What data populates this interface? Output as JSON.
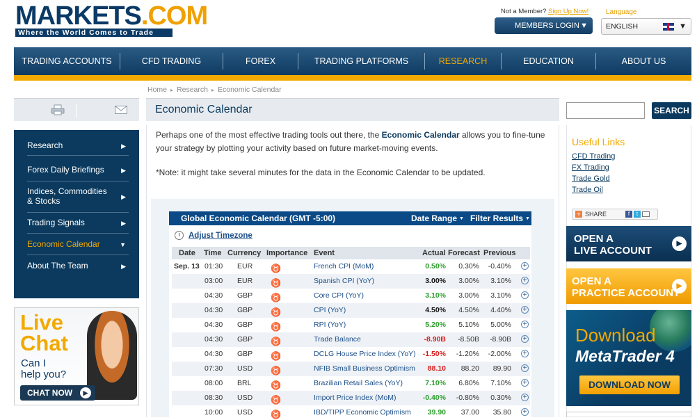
{
  "header": {
    "logo_main": "MARKETS",
    "logo_dot": ".COM",
    "logo_tagline": "Where the World Comes to Trade",
    "not_member": "Not a Member?",
    "signup": "Sign Up Now!",
    "members_login": "MEMBERS LOGIN",
    "language_label": "Language",
    "language_value": "ENGLISH"
  },
  "nav": [
    "TRADING ACCOUNTS",
    "CFD TRADING",
    "FOREX",
    "TRADING PLATFORMS",
    "RESEARCH",
    "EDUCATION",
    "ABOUT US"
  ],
  "breadcrumb": [
    "Home",
    "Research",
    "Economic Calendar"
  ],
  "sidebar": {
    "items": [
      "Research",
      "Forex Daily Briefings",
      "Indices, Commodities & Stocks",
      "Trading Signals",
      "Economic Calendar",
      "About The Team"
    ],
    "active_index": 4
  },
  "livechat": {
    "line1": "Live",
    "line2": "Chat",
    "q1": "Can I",
    "q2": "help you?",
    "button": "CHAT NOW"
  },
  "main": {
    "title": "Economic Calendar",
    "intro_before": "Perhaps one of the most effective trading tools out there, the ",
    "intro_bold": "Economic Calendar",
    "intro_after": " allows you to fine-tune your strategy by plotting your activity based on future market-moving events.",
    "note": "*Note: it might take several minutes for the data in the Economic Calendar to be updated."
  },
  "calendar": {
    "title": "Global Economic Calendar (GMT -5:00)",
    "date_range": "Date Range",
    "filter": "Filter Results",
    "adjust_timezone": "Adjust Timezone",
    "columns": [
      "Date",
      "Time",
      "Currency",
      "Importance",
      "Event",
      "Actual",
      "Forecast",
      "Previous"
    ],
    "rows": [
      {
        "date": "Sep. 13",
        "time": "01:30",
        "currency": "EUR",
        "importance": 2,
        "event": "French CPI (MoM)",
        "actual": "0.50%",
        "actual_tone": "pos",
        "forecast": "0.30%",
        "previous": "-0.40%"
      },
      {
        "date": "",
        "time": "03:00",
        "currency": "EUR",
        "importance": 2,
        "event": "Spanish CPI (YoY)",
        "actual": "3.00%",
        "actual_tone": "neu",
        "forecast": "3.00%",
        "previous": "3.10%"
      },
      {
        "date": "",
        "time": "04:30",
        "currency": "GBP",
        "importance": 2,
        "event": "Core CPI (YoY)",
        "actual": "3.10%",
        "actual_tone": "pos",
        "forecast": "3.00%",
        "previous": "3.10%"
      },
      {
        "date": "",
        "time": "04:30",
        "currency": "GBP",
        "importance": 2,
        "event": "CPI (YoY)",
        "actual": "4.50%",
        "actual_tone": "neu",
        "forecast": "4.50%",
        "previous": "4.40%"
      },
      {
        "date": "",
        "time": "04:30",
        "currency": "GBP",
        "importance": 2,
        "event": "RPI (YoY)",
        "actual": "5.20%",
        "actual_tone": "pos",
        "forecast": "5.10%",
        "previous": "5.00%"
      },
      {
        "date": "",
        "time": "04:30",
        "currency": "GBP",
        "importance": 2,
        "event": "Trade Balance",
        "actual": "-8.90B",
        "actual_tone": "neg",
        "forecast": "-8.50B",
        "previous": "-8.90B"
      },
      {
        "date": "",
        "time": "04:30",
        "currency": "GBP",
        "importance": 2,
        "event": "DCLG House Price Index (YoY)",
        "actual": "-1.50%",
        "actual_tone": "neg",
        "forecast": "-1.20%",
        "previous": "-2.00%"
      },
      {
        "date": "",
        "time": "07:30",
        "currency": "USD",
        "importance": 2,
        "event": "NFIB Small Business Optimism",
        "actual": "88.10",
        "actual_tone": "neg",
        "forecast": "88.20",
        "previous": "89.90"
      },
      {
        "date": "",
        "time": "08:00",
        "currency": "BRL",
        "importance": 2,
        "event": "Brazilian Retail Sales (YoY)",
        "actual": "7.10%",
        "actual_tone": "pos",
        "forecast": "6.80%",
        "previous": "7.10%"
      },
      {
        "date": "",
        "time": "08:30",
        "currency": "USD",
        "importance": 2,
        "event": "Import Price Index (MoM)",
        "actual": "-0.40%",
        "actual_tone": "pos",
        "forecast": "-0.80%",
        "previous": "0.30%"
      },
      {
        "date": "",
        "time": "10:00",
        "currency": "USD",
        "importance": 2,
        "event": "IBD/TIPP Economic Optimism",
        "actual": "39.90",
        "actual_tone": "pos",
        "forecast": "37.00",
        "previous": "35.80"
      }
    ]
  },
  "right": {
    "search_button": "SEARCH",
    "useful_links_title": "Useful Links",
    "links": [
      "CFD Trading",
      "FX Trading",
      "Trade Gold",
      "Trade Oil"
    ],
    "share": "SHARE",
    "live_account_1": "OPEN A",
    "live_account_2": "LIVE ACCOUNT",
    "practice_1": "OPEN A",
    "practice_2": "PRACTICE ACCOUNT",
    "download_1": "Download",
    "download_2": "MetaTrader 4",
    "download_btn": "DOWNLOAD NOW"
  },
  "colors": {
    "brand_navy": "#0b3a5e",
    "accent_orange": "#f2a900",
    "positive": "#2e9e2e",
    "negative": "#d81c1c"
  }
}
